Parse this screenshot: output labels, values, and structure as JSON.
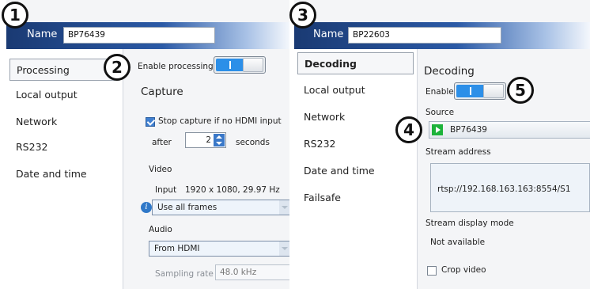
{
  "left": {
    "name_label": "Name",
    "name_value": "BP76439",
    "sidebar": [
      {
        "label": "Processing"
      },
      {
        "label": "Local output"
      },
      {
        "label": "Network"
      },
      {
        "label": "RS232"
      },
      {
        "label": "Date and time"
      }
    ],
    "enable_label": "Enable processing",
    "capture_heading": "Capture",
    "stop_capture_label": "Stop capture if no HDMI input",
    "after_label": "after",
    "after_value": "2",
    "seconds_label": "seconds",
    "video_label": "Video",
    "input_label": "Input",
    "input_value": "1920 x 1080, 29.97 Hz",
    "frames_select": "Use all frames",
    "audio_label": "Audio",
    "audio_select": "From HDMI",
    "sampling_label": "Sampling rate",
    "sampling_value": "48.0 kHz"
  },
  "right": {
    "name_label": "Name",
    "name_value": "BP22603",
    "sidebar": [
      {
        "label": "Decoding"
      },
      {
        "label": "Local output"
      },
      {
        "label": "Network"
      },
      {
        "label": "RS232"
      },
      {
        "label": "Date and time"
      },
      {
        "label": "Failsafe"
      }
    ],
    "decoding_heading": "Decoding",
    "enable_label": "Enable",
    "source_label": "Source",
    "source_value": "BP76439",
    "stream_address_label": "Stream address",
    "stream_address_value": "rtsp://192.168.163.163:8554/S1",
    "stream_mode_label": "Stream display mode",
    "stream_mode_value": "Not available",
    "crop_label": "Crop video"
  },
  "callouts": [
    "1",
    "2",
    "3",
    "4",
    "5"
  ],
  "colors": {
    "header_dark": "#1a3a73",
    "toggle_on": "#2c8fe8",
    "play_green": "#1db33b"
  }
}
